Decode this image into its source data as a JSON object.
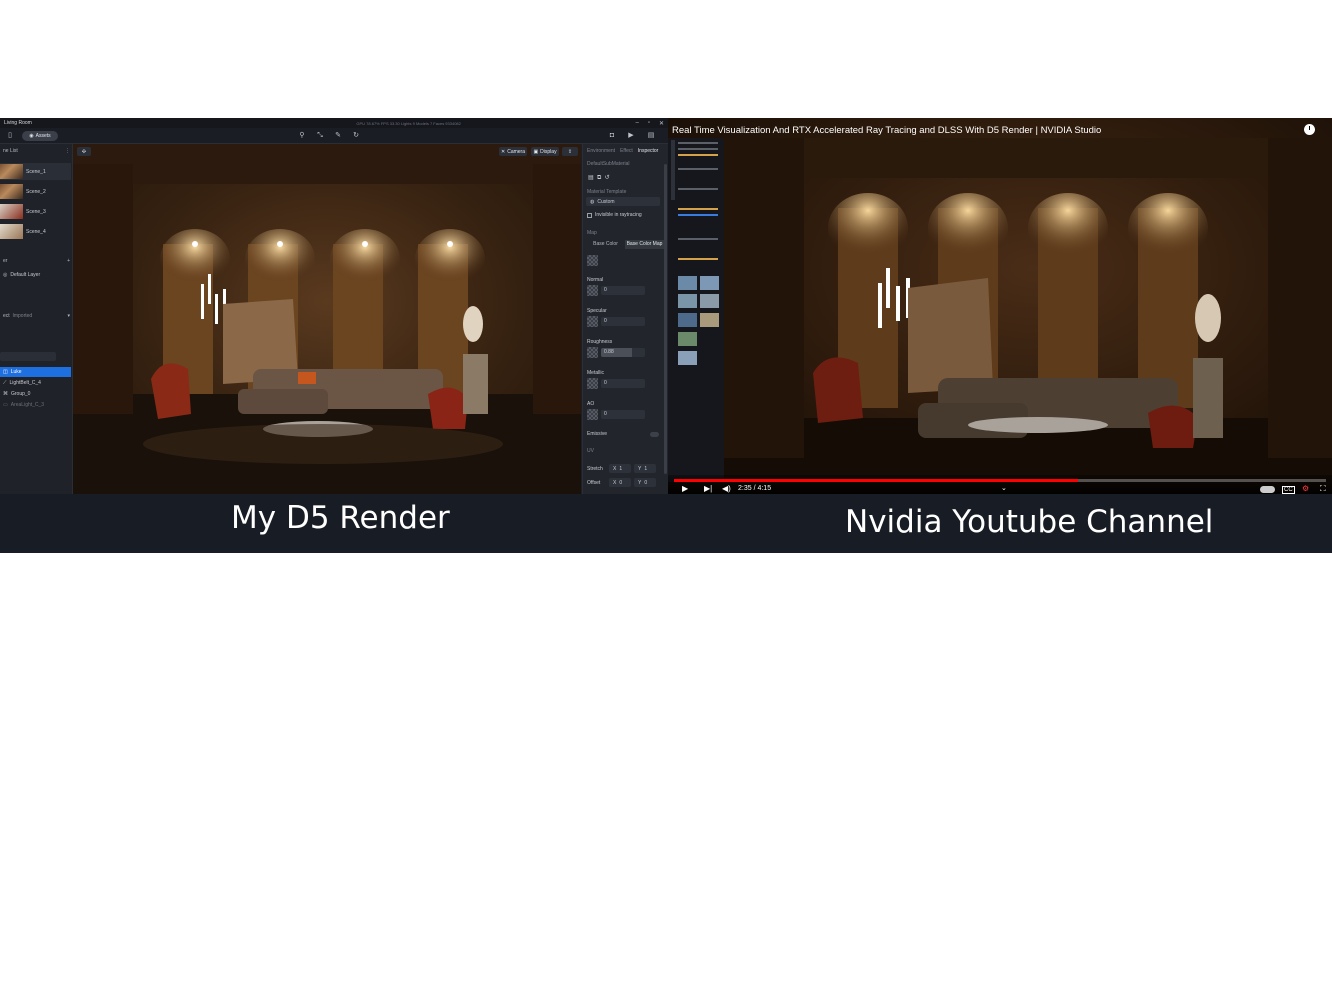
{
  "d5": {
    "window_title": "Living Room",
    "stats": "GPU 78.67%    FPS 33.30    Lights 9    Models 7    Faces 9334082",
    "assets_label": "Assets",
    "scene_list_label": "ne List",
    "scenes": [
      "Scene_1",
      "Scene_2",
      "Scene_3",
      "Scene_4"
    ],
    "layer_label": "er",
    "default_layer": "Default Layer",
    "object_tabs": [
      "ect",
      "Imported"
    ],
    "objects": [
      "Luke",
      "LightBelt_C_4",
      "Group_0",
      "AreaLight_C_3"
    ],
    "viewport_buttons": [
      "Camera",
      "Display"
    ],
    "inspector": {
      "tabs": [
        "Environment",
        "Effect",
        "Inspector"
      ],
      "material_name": "DefaultSubMaterial",
      "template_label": "Material Template",
      "template_value": "Custom",
      "invisible_label": "Invisible in raytracing",
      "map_label": "Map",
      "map_tabs": [
        "Base Color",
        "Base Color Map"
      ],
      "normal_label": "Normal",
      "normal_value": "0",
      "specular_label": "Specular",
      "specular_value": "0",
      "roughness_label": "Roughness",
      "roughness_value": "0.88",
      "metallic_label": "Metallic",
      "metallic_value": "0",
      "ao_label": "AO",
      "ao_value": "0",
      "emissive_label": "Emissive",
      "uv_label": "UV",
      "stretch_label": "Stretch",
      "stretch_x": "1",
      "stretch_y": "1",
      "offset_label": "Offset",
      "offset_x": "0",
      "offset_y": "0"
    }
  },
  "youtube": {
    "title": "Real Time Visualization And RTX Accelerated Ray Tracing and DLSS With D5 Render | NVIDIA Studio",
    "time": "2:35 / 4:15",
    "progress_fraction": 0.62,
    "buffered_fraction": 0.62
  },
  "captions": {
    "left": "My D5 Render",
    "right": "Nvidia Youtube Channel"
  },
  "colors": {
    "selection_blue": "#1e6fe0",
    "youtube_red": "#ff0000"
  }
}
